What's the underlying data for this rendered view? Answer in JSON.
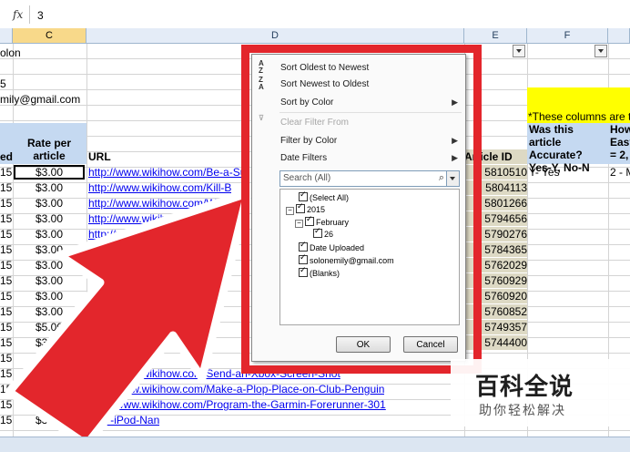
{
  "formula_bar": {
    "fx": "fx",
    "value": "3"
  },
  "columns": [
    "C",
    "D",
    "E",
    "F"
  ],
  "cells": {
    "colon": "olon",
    "five": "5",
    "email": "mily@gmail.com",
    "hdr_ed": "ed",
    "hdr_rate": "Rate per article",
    "hdr_url": "URL",
    "hdr_article_id": "Article ID",
    "note_yellow": "*These columns are to",
    "hdr_accurate": "Was this article Accurate? Yes-Y, No-N",
    "hdr_how": "How Easy = 2,",
    "yes_value": "Y- Yes",
    "two_value": "2 - M"
  },
  "rows": [
    {
      "b": "15",
      "c": "$3.00",
      "url": "http://www.wikihow.com/Be-a-Su",
      "id": "5810510"
    },
    {
      "b": "15",
      "c": "$3.00",
      "url": "http://www.wikihow.com/Kill-B",
      "id": "5804113"
    },
    {
      "b": "15",
      "c": "$3.00",
      "url": "http://www.wikihow.com/Wi",
      "id": "5801266"
    },
    {
      "b": "15",
      "c": "$3.00",
      "url": "http://www.wikihow.com/W",
      "id": "5794656"
    },
    {
      "b": "15",
      "c": "$3.00",
      "url": "http://www.wikihow.com/",
      "id": "5790276"
    },
    {
      "b": "15",
      "c": "$3.00",
      "url": "http://www.wi",
      "id": "5784365"
    },
    {
      "b": "15",
      "c": "$3.00",
      "url": "",
      "id": "5762029"
    },
    {
      "b": "15",
      "c": "$3.00",
      "url": "",
      "id": "5760929"
    },
    {
      "b": "15",
      "c": "$3.00",
      "url": "",
      "id": "5760920"
    },
    {
      "b": "15",
      "c": "$3.00",
      "url": "",
      "id": "5760852"
    },
    {
      "b": "15",
      "c": "$5.00",
      "url": "",
      "id": "5749357"
    },
    {
      "b": "15",
      "c": "$3.00",
      "url": "",
      "id": "5744400"
    },
    {
      "b": "15",
      "c": "$3.0",
      "url": "",
      "id": ""
    },
    {
      "b": "15",
      "c": "$3.00",
      "url": "http://www.wikihow.com/Send-an-Xbox-Screen-Shot",
      "id": ""
    },
    {
      "b": "15",
      "c": "$3.00",
      "url": "http://www.wikihow.com/Make-a-Plop-Place-on-Club-Penguin",
      "id": ""
    },
    {
      "b": "15",
      "c": "$3.00",
      "url": "http://www.wikihow.com/Program-the-Garmin-Forerunner-301",
      "id": ""
    },
    {
      "b": "15",
      "c": "$3.00",
      "url": "Your-iPod-Nan",
      "id": ""
    }
  ],
  "filter_menu": {
    "sort_oldest": "Sort Oldest to Newest",
    "sort_newest": "Sort Newest to Oldest",
    "sort_color": "Sort by Color",
    "clear_filter": "Clear Filter From",
    "filter_color": "Filter by Color",
    "date_filters": "Date Filters",
    "search_placeholder": "Search (All)",
    "tree": {
      "select_all": "(Select All)",
      "year": "2015",
      "month": "February",
      "day": "26",
      "date_uploaded": "Date Uploaded",
      "email": "solonemily@gmail.com",
      "blanks": "(Blanks)"
    },
    "ok": "OK",
    "cancel": "Cancel"
  },
  "watermark": {
    "title": "百科全说",
    "subtitle": "助你轻松解决"
  },
  "colors": {
    "red_frame": "#e3262c",
    "header_blue": "#c5d9f1",
    "note_yellow": "#ffff00",
    "link": "#0000ee"
  }
}
